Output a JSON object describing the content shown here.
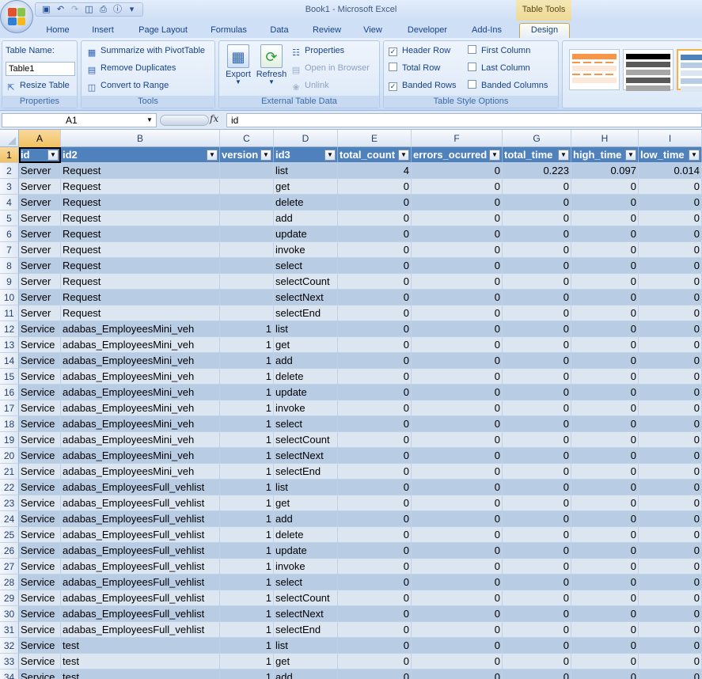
{
  "window": {
    "title": "Book1 - Microsoft Excel",
    "context_tab_group": "Table Tools"
  },
  "qat": {
    "icons": [
      "save-icon",
      "undo-icon",
      "redo-icon",
      "print-preview-icon",
      "print-icon",
      "info-icon",
      "customize-icon"
    ]
  },
  "tabs": [
    "Home",
    "Insert",
    "Page Layout",
    "Formulas",
    "Data",
    "Review",
    "View",
    "Developer",
    "Add-Ins",
    "Design"
  ],
  "ribbon": {
    "properties": {
      "label": "Properties",
      "table_name_label": "Table Name:",
      "table_name_value": "Table1",
      "resize_table": "Resize Table"
    },
    "tools": {
      "label": "Tools",
      "summarize": "Summarize with PivotTable",
      "remove_duplicates": "Remove Duplicates",
      "convert_to_range": "Convert to Range"
    },
    "external": {
      "label": "External Table Data",
      "export": "Export",
      "refresh": "Refresh",
      "properties": "Properties",
      "open_in_browser": "Open in Browser",
      "unlink": "Unlink"
    },
    "style_options": {
      "label": "Table Style Options",
      "header_row": {
        "label": "Header Row",
        "checked": true
      },
      "total_row": {
        "label": "Total Row",
        "checked": false
      },
      "banded_rows": {
        "label": "Banded Rows",
        "checked": true
      },
      "first_column": {
        "label": "First Column",
        "checked": false
      },
      "last_column": {
        "label": "Last Column",
        "checked": false
      },
      "banded_columns": {
        "label": "Banded Columns",
        "checked": false
      }
    }
  },
  "formula_bar": {
    "name_box": "A1",
    "fx": "fx",
    "formula": "id"
  },
  "columns": [
    {
      "letter": "A",
      "header": "id"
    },
    {
      "letter": "B",
      "header": "id2"
    },
    {
      "letter": "C",
      "header": "version"
    },
    {
      "letter": "D",
      "header": "id3"
    },
    {
      "letter": "E",
      "header": "total_count"
    },
    {
      "letter": "F",
      "header": "errors_ocurred"
    },
    {
      "letter": "G",
      "header": "total_time"
    },
    {
      "letter": "H",
      "header": "high_time"
    },
    {
      "letter": "I",
      "header": "low_time"
    }
  ],
  "rows": [
    [
      "2",
      "Server",
      "Request",
      "",
      "list",
      "4",
      "0",
      "0.223",
      "0.097",
      "0.014"
    ],
    [
      "3",
      "Server",
      "Request",
      "",
      "get",
      "0",
      "0",
      "0",
      "0",
      "0"
    ],
    [
      "4",
      "Server",
      "Request",
      "",
      "delete",
      "0",
      "0",
      "0",
      "0",
      "0"
    ],
    [
      "5",
      "Server",
      "Request",
      "",
      "add",
      "0",
      "0",
      "0",
      "0",
      "0"
    ],
    [
      "6",
      "Server",
      "Request",
      "",
      "update",
      "0",
      "0",
      "0",
      "0",
      "0"
    ],
    [
      "7",
      "Server",
      "Request",
      "",
      "invoke",
      "0",
      "0",
      "0",
      "0",
      "0"
    ],
    [
      "8",
      "Server",
      "Request",
      "",
      "select",
      "0",
      "0",
      "0",
      "0",
      "0"
    ],
    [
      "9",
      "Server",
      "Request",
      "",
      "selectCount",
      "0",
      "0",
      "0",
      "0",
      "0"
    ],
    [
      "10",
      "Server",
      "Request",
      "",
      "selectNext",
      "0",
      "0",
      "0",
      "0",
      "0"
    ],
    [
      "11",
      "Server",
      "Request",
      "",
      "selectEnd",
      "0",
      "0",
      "0",
      "0",
      "0"
    ],
    [
      "12",
      "Service",
      "adabas_EmployeesMini_veh",
      "1",
      "list",
      "0",
      "0",
      "0",
      "0",
      "0"
    ],
    [
      "13",
      "Service",
      "adabas_EmployeesMini_veh",
      "1",
      "get",
      "0",
      "0",
      "0",
      "0",
      "0"
    ],
    [
      "14",
      "Service",
      "adabas_EmployeesMini_veh",
      "1",
      "add",
      "0",
      "0",
      "0",
      "0",
      "0"
    ],
    [
      "15",
      "Service",
      "adabas_EmployeesMini_veh",
      "1",
      "delete",
      "0",
      "0",
      "0",
      "0",
      "0"
    ],
    [
      "16",
      "Service",
      "adabas_EmployeesMini_veh",
      "1",
      "update",
      "0",
      "0",
      "0",
      "0",
      "0"
    ],
    [
      "17",
      "Service",
      "adabas_EmployeesMini_veh",
      "1",
      "invoke",
      "0",
      "0",
      "0",
      "0",
      "0"
    ],
    [
      "18",
      "Service",
      "adabas_EmployeesMini_veh",
      "1",
      "select",
      "0",
      "0",
      "0",
      "0",
      "0"
    ],
    [
      "19",
      "Service",
      "adabas_EmployeesMini_veh",
      "1",
      "selectCount",
      "0",
      "0",
      "0",
      "0",
      "0"
    ],
    [
      "20",
      "Service",
      "adabas_EmployeesMini_veh",
      "1",
      "selectNext",
      "0",
      "0",
      "0",
      "0",
      "0"
    ],
    [
      "21",
      "Service",
      "adabas_EmployeesMini_veh",
      "1",
      "selectEnd",
      "0",
      "0",
      "0",
      "0",
      "0"
    ],
    [
      "22",
      "Service",
      "adabas_EmployeesFull_vehlist",
      "1",
      "list",
      "0",
      "0",
      "0",
      "0",
      "0"
    ],
    [
      "23",
      "Service",
      "adabas_EmployeesFull_vehlist",
      "1",
      "get",
      "0",
      "0",
      "0",
      "0",
      "0"
    ],
    [
      "24",
      "Service",
      "adabas_EmployeesFull_vehlist",
      "1",
      "add",
      "0",
      "0",
      "0",
      "0",
      "0"
    ],
    [
      "25",
      "Service",
      "adabas_EmployeesFull_vehlist",
      "1",
      "delete",
      "0",
      "0",
      "0",
      "0",
      "0"
    ],
    [
      "26",
      "Service",
      "adabas_EmployeesFull_vehlist",
      "1",
      "update",
      "0",
      "0",
      "0",
      "0",
      "0"
    ],
    [
      "27",
      "Service",
      "adabas_EmployeesFull_vehlist",
      "1",
      "invoke",
      "0",
      "0",
      "0",
      "0",
      "0"
    ],
    [
      "28",
      "Service",
      "adabas_EmployeesFull_vehlist",
      "1",
      "select",
      "0",
      "0",
      "0",
      "0",
      "0"
    ],
    [
      "29",
      "Service",
      "adabas_EmployeesFull_vehlist",
      "1",
      "selectCount",
      "0",
      "0",
      "0",
      "0",
      "0"
    ],
    [
      "30",
      "Service",
      "adabas_EmployeesFull_vehlist",
      "1",
      "selectNext",
      "0",
      "0",
      "0",
      "0",
      "0"
    ],
    [
      "31",
      "Service",
      "adabas_EmployeesFull_vehlist",
      "1",
      "selectEnd",
      "0",
      "0",
      "0",
      "0",
      "0"
    ],
    [
      "32",
      "Service",
      "test",
      "1",
      "list",
      "0",
      "0",
      "0",
      "0",
      "0"
    ],
    [
      "33",
      "Service",
      "test",
      "1",
      "get",
      "0",
      "0",
      "0",
      "0",
      "0"
    ],
    [
      "34",
      "Service",
      "test",
      "1",
      "add",
      "0",
      "0",
      "0",
      "0",
      "0"
    ]
  ],
  "colors": {
    "table_header": "#4f81bd",
    "band_dark": "#b8cce4",
    "band_light": "#dce6f1",
    "ribbon": "#d6e4f7"
  }
}
